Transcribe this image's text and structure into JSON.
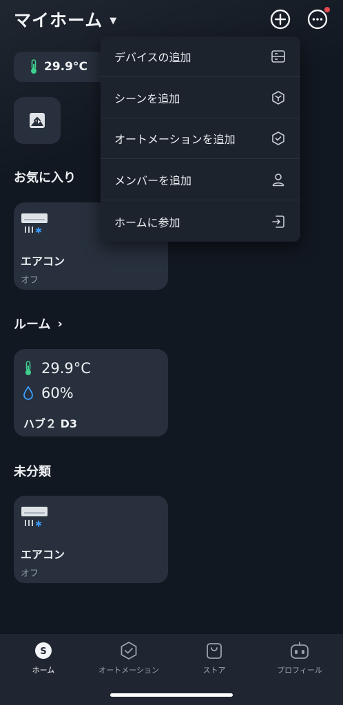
{
  "header": {
    "title": "マイホーム",
    "caret_icon": "caret-down-icon",
    "add_icon": "plus-circle-icon",
    "more_icon": "more-horizontal-icon",
    "badge_color": "#e5484d"
  },
  "summary": {
    "temperature": "29.9°C"
  },
  "favorites": {
    "title": "お気に入り",
    "devices": [
      {
        "name": "エアコン",
        "status": "オフ"
      }
    ]
  },
  "rooms": {
    "title": "ルーム",
    "cards": [
      {
        "temperature": "29.9°C",
        "humidity": "60%",
        "name": "ハブ２ D3"
      }
    ]
  },
  "uncategorized": {
    "title": "未分類",
    "devices": [
      {
        "name": "エアコン",
        "status": "オフ"
      }
    ]
  },
  "menu": {
    "items": [
      {
        "label": "デバイスの追加",
        "icon": "device-icon"
      },
      {
        "label": "シーンを追加",
        "icon": "scene-icon"
      },
      {
        "label": "オートメーションを追加",
        "icon": "automation-check-icon"
      },
      {
        "label": "メンバーを追加",
        "icon": "person-icon"
      },
      {
        "label": "ホームに参加",
        "icon": "enter-icon"
      }
    ]
  },
  "nav": {
    "items": [
      {
        "label": "ホーム",
        "active": true
      },
      {
        "label": "オートメーション",
        "active": false
      },
      {
        "label": "ストア",
        "active": false
      },
      {
        "label": "プロフィール",
        "active": false
      }
    ]
  },
  "colors": {
    "background": "#121821",
    "card": "#27303c",
    "accent_green": "#3ecf8e",
    "accent_blue": "#3b9bff"
  }
}
